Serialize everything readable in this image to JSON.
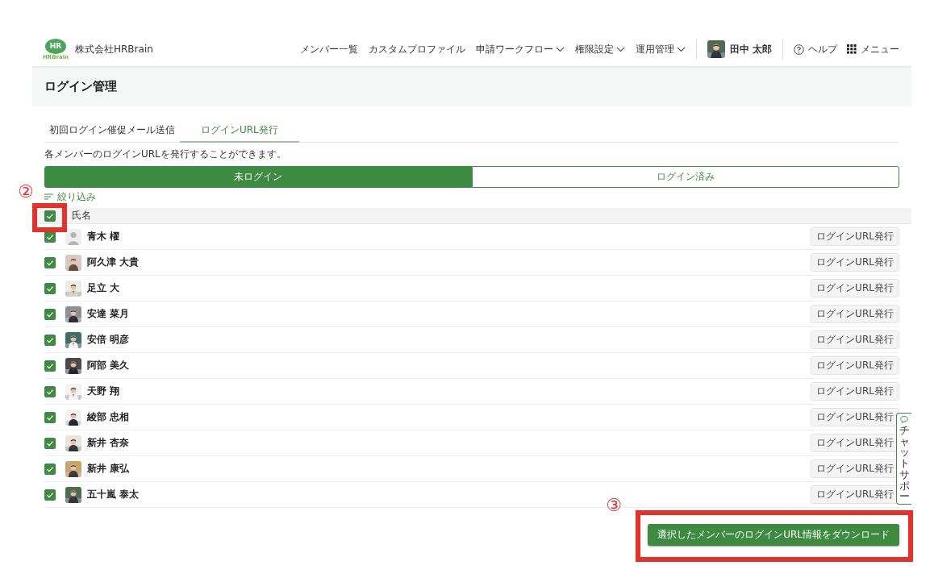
{
  "header": {
    "logo": {
      "badge": "HR",
      "wordmark": "HRBrain"
    },
    "company": "株式会社HRBrain",
    "nav": [
      {
        "label": "メンバー一覧",
        "dropdown": false
      },
      {
        "label": "カスタムプロファイル",
        "dropdown": false
      },
      {
        "label": "申請ワークフロー",
        "dropdown": true
      },
      {
        "label": "権限設定",
        "dropdown": true
      },
      {
        "label": "運用管理",
        "dropdown": true
      }
    ],
    "user": {
      "name": "田中 太郎"
    },
    "help": "ヘルプ",
    "menu": "メニュー"
  },
  "page_title": "ログイン管理",
  "tabs": [
    {
      "label": "初回ログイン催促メール送信",
      "selected": false
    },
    {
      "label": "ログインURL発行",
      "selected": true
    }
  ],
  "description": "各メンバーのログインURLを発行することができます。",
  "segments": [
    {
      "label": "未ログイン",
      "selected": true
    },
    {
      "label": "ログイン済み",
      "selected": false
    }
  ],
  "filter": "絞り込み",
  "table": {
    "header": {
      "label": "氏名",
      "checked": true
    },
    "rows": [
      {
        "name": "青木 櫂",
        "checked": true,
        "avatar": {
          "kind": "silhouette"
        },
        "action": "ログインURL発行"
      },
      {
        "name": "阿久津 大貴",
        "checked": true,
        "action": "ログインURL発行"
      },
      {
        "name": "足立 大",
        "checked": true,
        "action": "ログインURL発行"
      },
      {
        "name": "安達 菜月",
        "checked": true,
        "action": "ログインURL発行"
      },
      {
        "name": "安倍 明彦",
        "checked": true,
        "action": "ログインURL発行"
      },
      {
        "name": "阿部 美久",
        "checked": true,
        "action": "ログインURL発行"
      },
      {
        "name": "天野 翔",
        "checked": true,
        "action": "ログインURL発行"
      },
      {
        "name": "綾部 忠相",
        "checked": true,
        "action": "ログインURL発行"
      },
      {
        "name": "新井 杏奈",
        "checked": true,
        "action": "ログインURL発行"
      },
      {
        "name": "新井 康弘",
        "checked": true,
        "action": "ログインURL発行"
      },
      {
        "name": "五十嵐 泰太",
        "checked": true,
        "action": "ログインURL発行"
      }
    ]
  },
  "download_button": "選択したメンバーのログインURL情報をダウンロード",
  "chat_support": "チャットサポー",
  "annotations": [
    {
      "label": "②",
      "kind": "select_all"
    },
    {
      "label": "③",
      "kind": "download"
    }
  ]
}
